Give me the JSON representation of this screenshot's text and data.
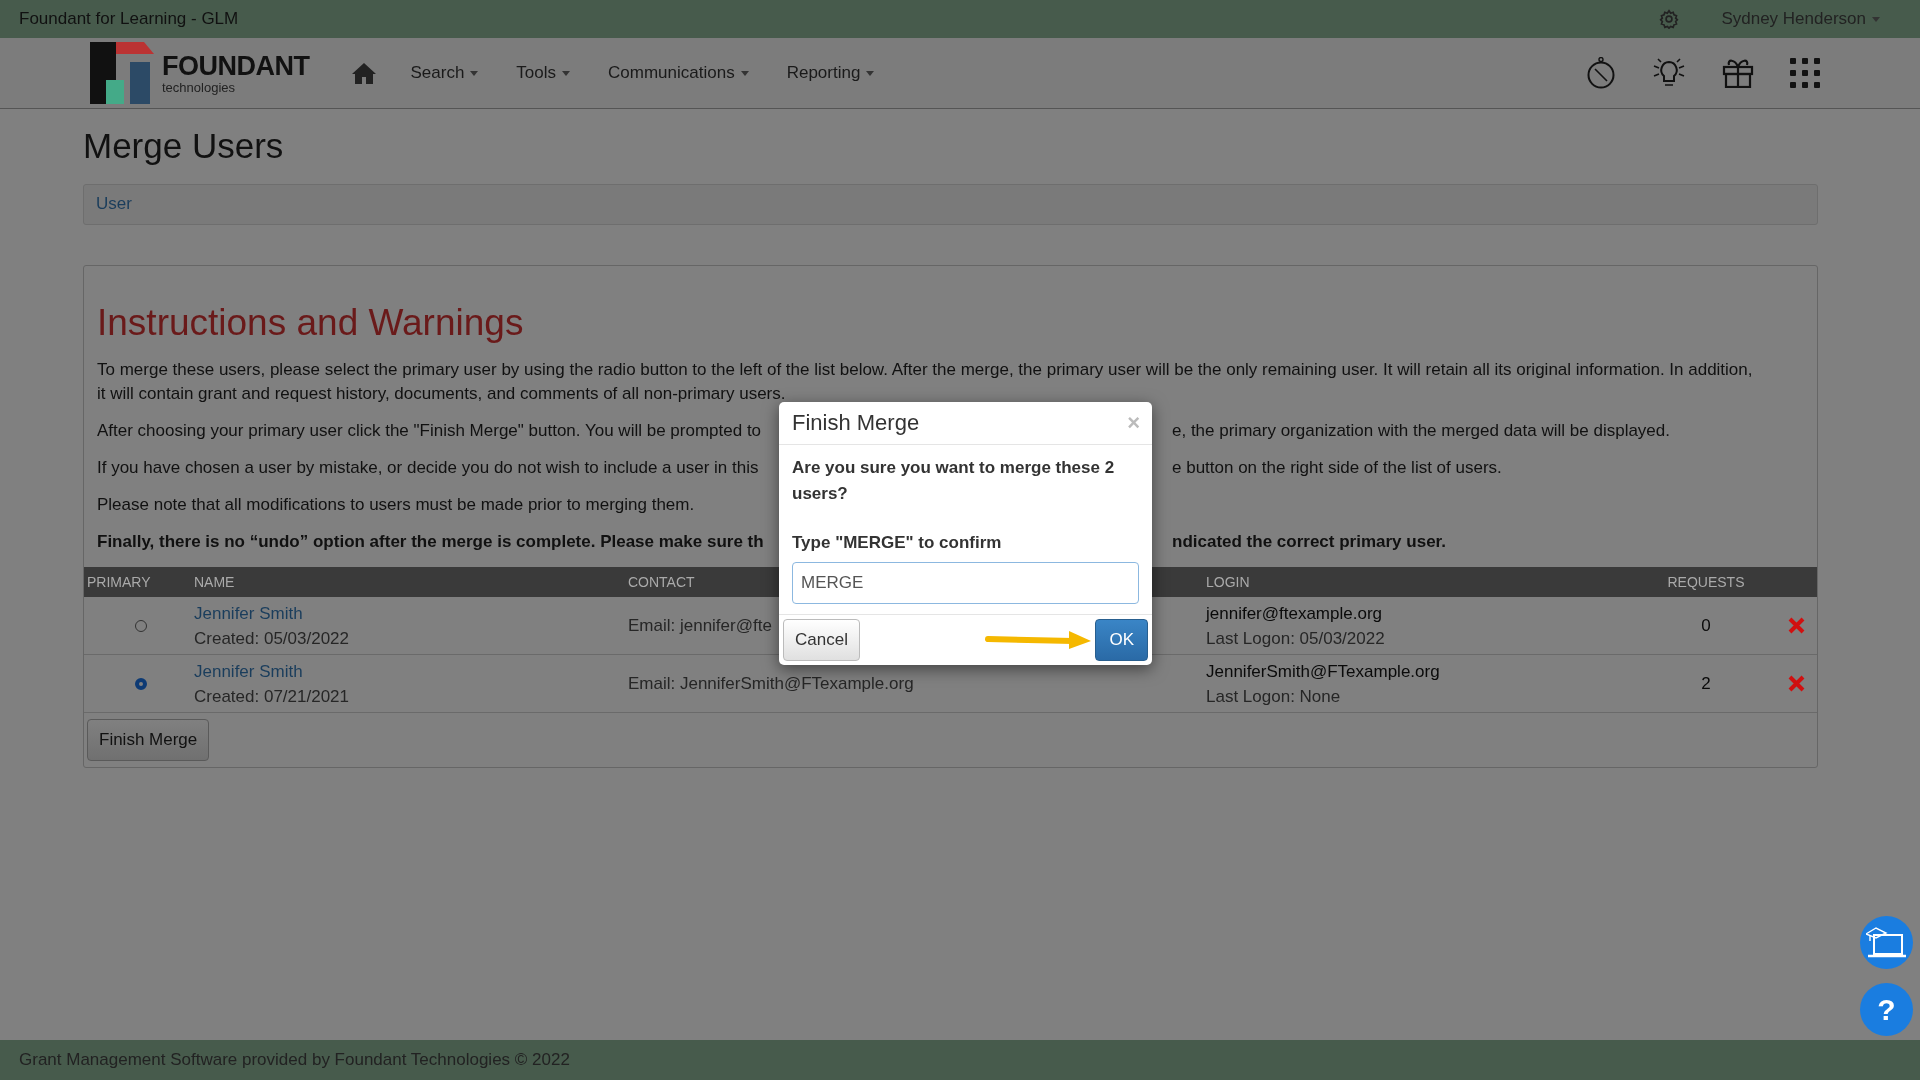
{
  "top_bar": {
    "app_title": "Foundant for Learning - GLM",
    "user_menu": "Sydney Henderson"
  },
  "logo": {
    "name": "FOUNDANT",
    "tagline": "technologies"
  },
  "nav": {
    "items": [
      {
        "label": "Search"
      },
      {
        "label": "Tools"
      },
      {
        "label": "Communications"
      },
      {
        "label": "Reporting"
      }
    ]
  },
  "page_title": "Merge Users",
  "breadcrumb": [
    "User"
  ],
  "instructions": {
    "heading": "Instructions and Warnings",
    "paragraphs": [
      {
        "bold": false,
        "lines": [
          {
            "left": "To merge these users, please select the primary user by using the radio button to the left of the list below. After the merge, the primary user will be the only remaining user. It will retain all its original information. In addition,"
          },
          {
            "left": "it will contain grant and request history, documents, and comments of all non-primary users."
          }
        ]
      },
      {
        "bold": false,
        "lines": [
          {
            "left": "After choosing your primary user click the \"Finish Merge\" button. You will be prompted to",
            "right": "e, the primary organization with the merged data will be displayed."
          }
        ]
      },
      {
        "bold": false,
        "lines": [
          {
            "left": "If you have chosen a user by mistake, or decide you do not wish to include a user in this",
            "right": "e button on the right side of the list of users."
          }
        ]
      },
      {
        "bold": false,
        "lines": [
          {
            "left": "Please note that all modifications to users must be made prior to merging them."
          }
        ]
      },
      {
        "bold": true,
        "lines": [
          {
            "left": "Finally, there is no “undo” option after the merge is complete. Please make sure th",
            "right": "ndicated the correct primary user."
          }
        ]
      }
    ]
  },
  "table": {
    "columns": [
      "PRIMARY",
      "NAME",
      "CONTACT",
      "LOGIN",
      "REQUESTS"
    ],
    "rows": [
      {
        "selected": false,
        "name": "Jennifer Smith",
        "created": "Created: 05/03/2022",
        "contact": "Email: jennifer@fte",
        "login": "jennifer@ftexample.org",
        "last_logon": "Last Logon: 05/03/2022",
        "requests": "0"
      },
      {
        "selected": true,
        "name": "Jennifer Smith",
        "created": "Created: 07/21/2021",
        "contact": "Email: JenniferSmith@FTexample.org",
        "login": "JenniferSmith@FTexample.org",
        "last_logon": "Last Logon: None",
        "requests": "2"
      }
    ]
  },
  "finish_button": "Finish Merge",
  "modal": {
    "title": "Finish Merge",
    "close": "×",
    "question": "Are you sure you want to merge these 2 users?",
    "confirm_label": "Type \"MERGE\" to confirm",
    "input_value": "MERGE",
    "cancel": "Cancel",
    "ok": "OK"
  },
  "help_button": "?",
  "footer": "Grant Management Software provided by Foundant Technologies © 2022"
}
